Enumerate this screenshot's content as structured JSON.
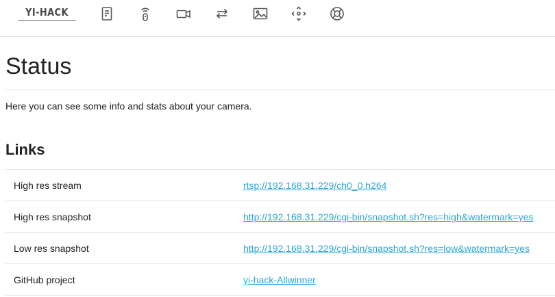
{
  "header": {
    "logo_text": "YI-HACK",
    "nav_icons": [
      "status-icon",
      "wifi-remote-icon",
      "camera-icon",
      "transfer-icon",
      "image-icon",
      "move-icon",
      "help-icon"
    ]
  },
  "page": {
    "title": "Status",
    "intro": "Here you can see some info and stats about your camera."
  },
  "links_section": {
    "title": "Links",
    "rows": [
      {
        "label": "High res stream",
        "link": "rtsp://192.168.31.229/ch0_0.h264"
      },
      {
        "label": "High res snapshot",
        "link": "http://192.168.31.229/cgi-bin/snapshot.sh?res=high&watermark=yes"
      },
      {
        "label": "Low res snapshot",
        "link": "http://192.168.31.229/cgi-bin/snapshot.sh?res=low&watermark=yes"
      },
      {
        "label": "GitHub project",
        "link": "yi-hack-Allwinner"
      }
    ]
  },
  "colors": {
    "link": "#2aa6d6",
    "icon": "#555555",
    "rule": "#e4e4e4"
  }
}
